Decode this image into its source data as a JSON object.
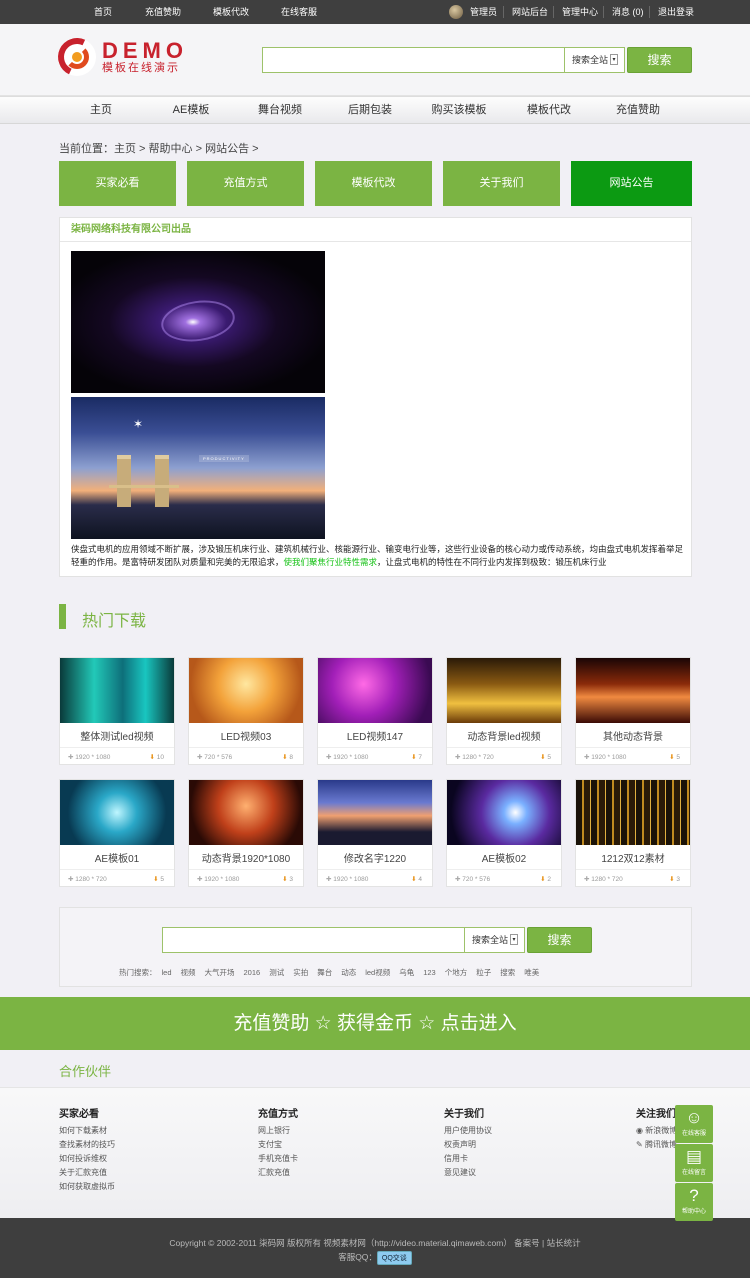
{
  "topbar": {
    "links": [
      "首页",
      "充值赞助",
      "模板代改",
      "在线客服"
    ],
    "user": "管理员",
    "right_links": [
      "网站后台",
      "管理中心",
      "消息 (0)",
      "退出登录"
    ]
  },
  "header": {
    "logo_text": "DEMO",
    "logo_sub": "模板在线演示",
    "search": {
      "value": "",
      "select": "搜索全站",
      "button": "搜索"
    }
  },
  "nav": [
    "主页",
    "AE模板",
    "舞台视频",
    "后期包装",
    "购买该模板",
    "模板代改",
    "充值赞助"
  ],
  "breadcrumb": "当前位置：主页 > 帮助中心 > 网站公告 >",
  "tabs": [
    {
      "label": "买家必看",
      "active": false
    },
    {
      "label": "充值方式",
      "active": false
    },
    {
      "label": "模板代改",
      "active": false
    },
    {
      "label": "关于我们",
      "active": false
    },
    {
      "label": "网站公告",
      "active": true
    }
  ],
  "article": {
    "title": "柒码网络科技有限公司出品",
    "img2_label": "PRODUCTIVITY",
    "para_1": "侠盘式电机的应用领域不断扩展，涉及锻压机床行业、建筑机械行业、核能源行业、输变电行业等，这些行业设备的核心动力或传动系统，均由盘式电机发挥着举足轻重的作用。是富特研发团队对质量和完美的无限追求，",
    "para_link": "使我们聚焦行业特性需求",
    "para_2": "，让盘式电机的特性在不同行业内发挥到极致：锻压机床行业"
  },
  "hot": {
    "title": "热门下载",
    "items": [
      {
        "title": "整体测试led视频",
        "res": "1920 * 1080",
        "dl": "10"
      },
      {
        "title": "LED视频03",
        "res": "720 * 576",
        "dl": "8"
      },
      {
        "title": "LED视频147",
        "res": "1920 * 1080",
        "dl": "7"
      },
      {
        "title": "动态背景led视频",
        "res": "1280 * 720",
        "dl": "5"
      },
      {
        "title": "其他动态背景",
        "res": "1920 * 1080",
        "dl": "5"
      },
      {
        "title": "AE模板01",
        "res": "1280 * 720",
        "dl": "5"
      },
      {
        "title": "动态背景1920*1080",
        "res": "1920 * 1080",
        "dl": "3"
      },
      {
        "title": "修改名字1220",
        "res": "1920 * 1080",
        "dl": "4"
      },
      {
        "title": "AE模板02",
        "res": "720 * 576",
        "dl": "2"
      },
      {
        "title": "1212双12素材",
        "res": "1280 * 720",
        "dl": "3"
      }
    ]
  },
  "search2": {
    "value": "",
    "select": "搜索全站",
    "button": "搜索",
    "hot_label": "热门搜索：",
    "keywords": [
      "led",
      "视频",
      "大气开场",
      "2016",
      "测试",
      "实拍",
      "舞台",
      "动态",
      "led视频",
      "乌龟",
      "123",
      "个地方",
      "粒子",
      "搜索",
      "唯美"
    ]
  },
  "banner": "充值赞助 ☆ 获得金币 ☆ 点击进入",
  "partner": "合作伙伴",
  "footer_cols": [
    {
      "title": "买家必看",
      "items": [
        "如何下载素材",
        "查找素材的技巧",
        "如何投诉维权",
        "关于汇款充值",
        "如何获取虚拟币"
      ]
    },
    {
      "title": "充值方式",
      "items": [
        "网上银行",
        "支付宝",
        "手机充值卡",
        "汇款充值"
      ]
    },
    {
      "title": "关于我们",
      "items": [
        "用户使用协议",
        "权责声明",
        "信用卡",
        "意见建议"
      ]
    },
    {
      "title": "关注我们",
      "items": [
        "新浪微博",
        "腾讯微博"
      ]
    }
  ],
  "copyright": "Copyright © 2002-2011 柒码网 版权所有 视频素材网（http://video.material.qimaweb.com） 备案号 | 站长统计",
  "qq_label": "客服QQ：",
  "qq_button": "QQ交谈",
  "float": [
    {
      "label": "在线客服",
      "icon": "qq-icon"
    },
    {
      "label": "在线留言",
      "icon": "message-icon"
    },
    {
      "label": "帮助中心",
      "icon": "help-icon"
    }
  ],
  "colors": {
    "accent": "#7bb443",
    "active_tab": "#0c9a12",
    "logo_red": "#c8222d",
    "topbar": "#3f3f3f"
  }
}
